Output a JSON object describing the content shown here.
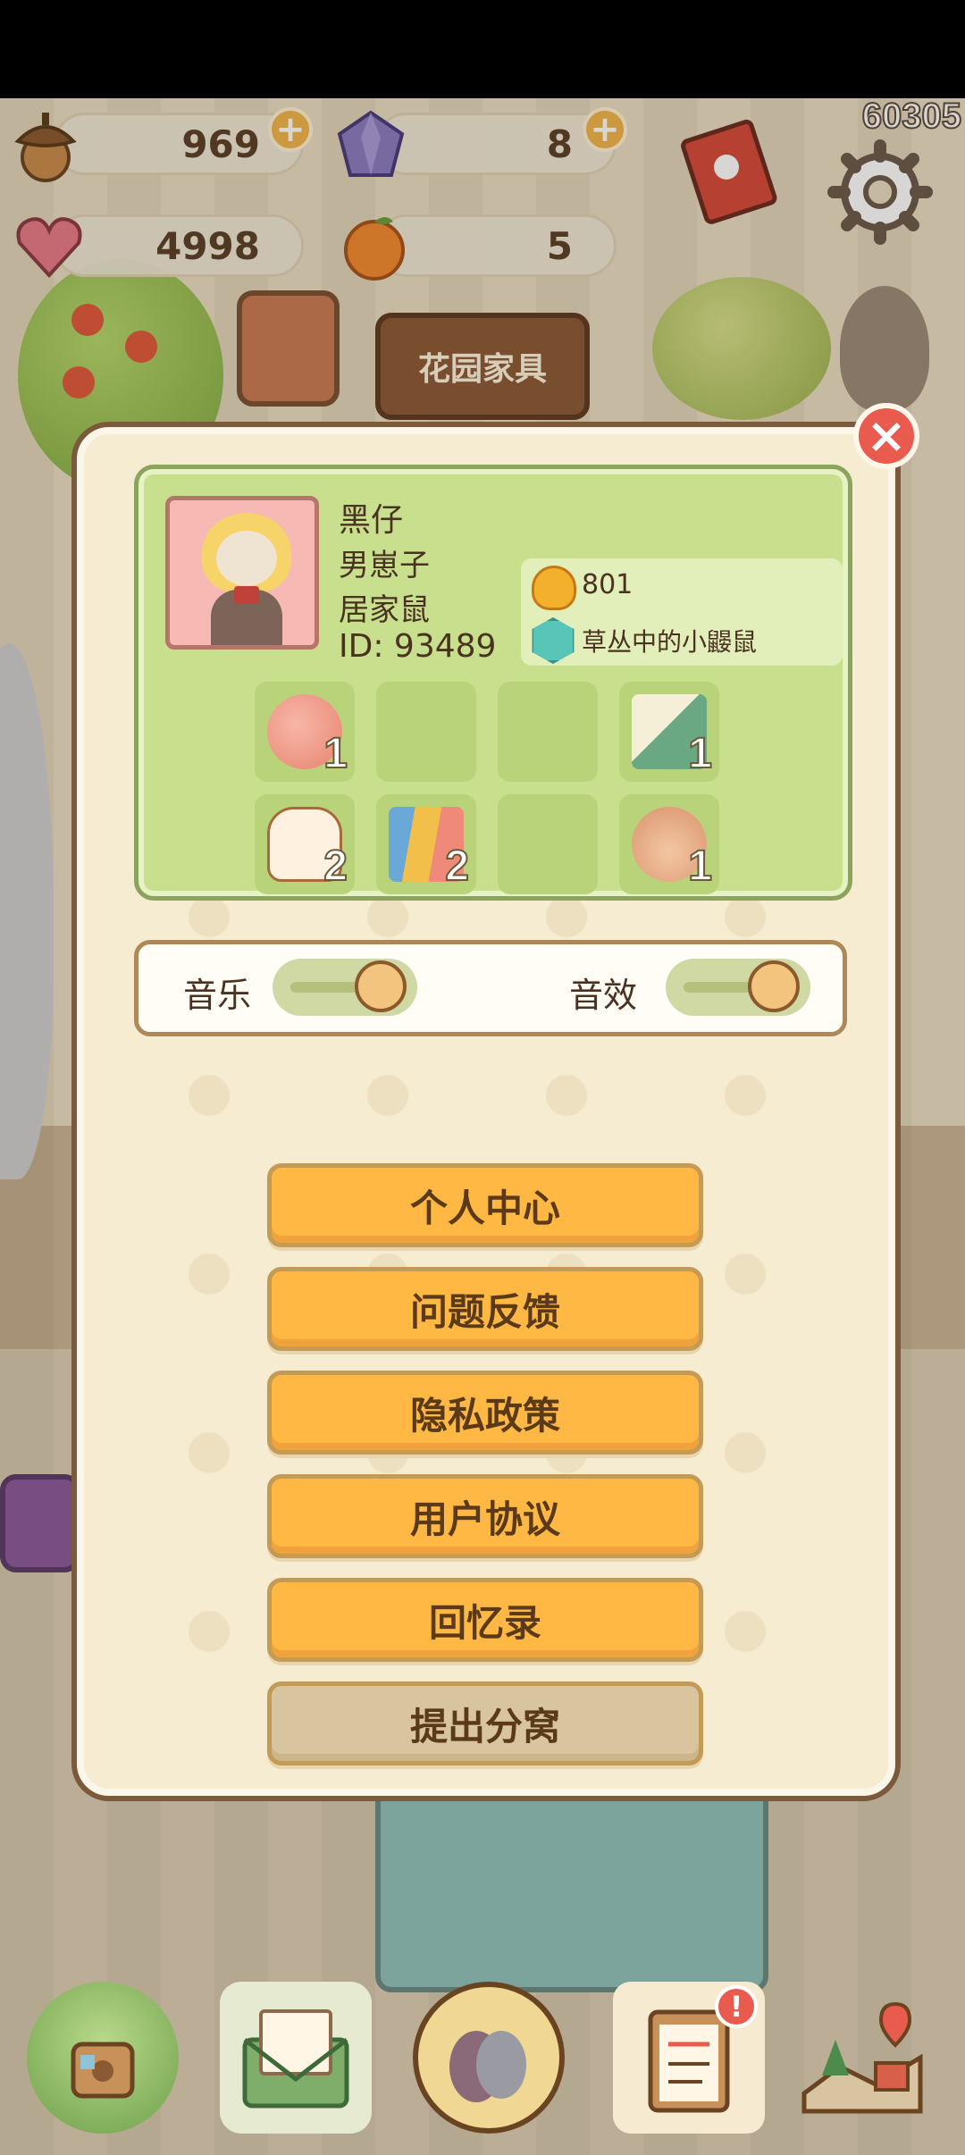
{
  "fps_counter": "60305",
  "resources": {
    "acorns": "969",
    "gems": "8",
    "hearts": "4998",
    "oranges": "5"
  },
  "background": {
    "shop_sign": "花园家具"
  },
  "profile": {
    "name": "黑仔",
    "gender": "男崽子",
    "title": "居家鼠",
    "id": "ID: 93489",
    "bells": "801",
    "badge": "草丛中的小鼹鼠"
  },
  "inventory": [
    {
      "icon": "peach-bun-icon",
      "count": "1"
    },
    {
      "icon": "empty-slot",
      "count": ""
    },
    {
      "icon": "empty-slot",
      "count": ""
    },
    {
      "icon": "scissors-icon",
      "count": "1"
    },
    {
      "icon": "flower-pot-icon",
      "count": "2"
    },
    {
      "icon": "cards-icon",
      "count": "2"
    },
    {
      "icon": "empty-slot",
      "count": ""
    },
    {
      "icon": "cat-paw-icon",
      "count": "1"
    }
  ],
  "settings": {
    "music_label": "音乐",
    "sfx_label": "音效"
  },
  "menu": {
    "personal_center": "个人中心",
    "feedback": "问题反馈",
    "privacy": "隐私政策",
    "user_agreement": "用户协议",
    "memories": "回忆录",
    "leave_nest": "提出分窝"
  },
  "nav_alerts": {
    "notes": "!"
  },
  "close_label": "×",
  "plus_label": "+"
}
